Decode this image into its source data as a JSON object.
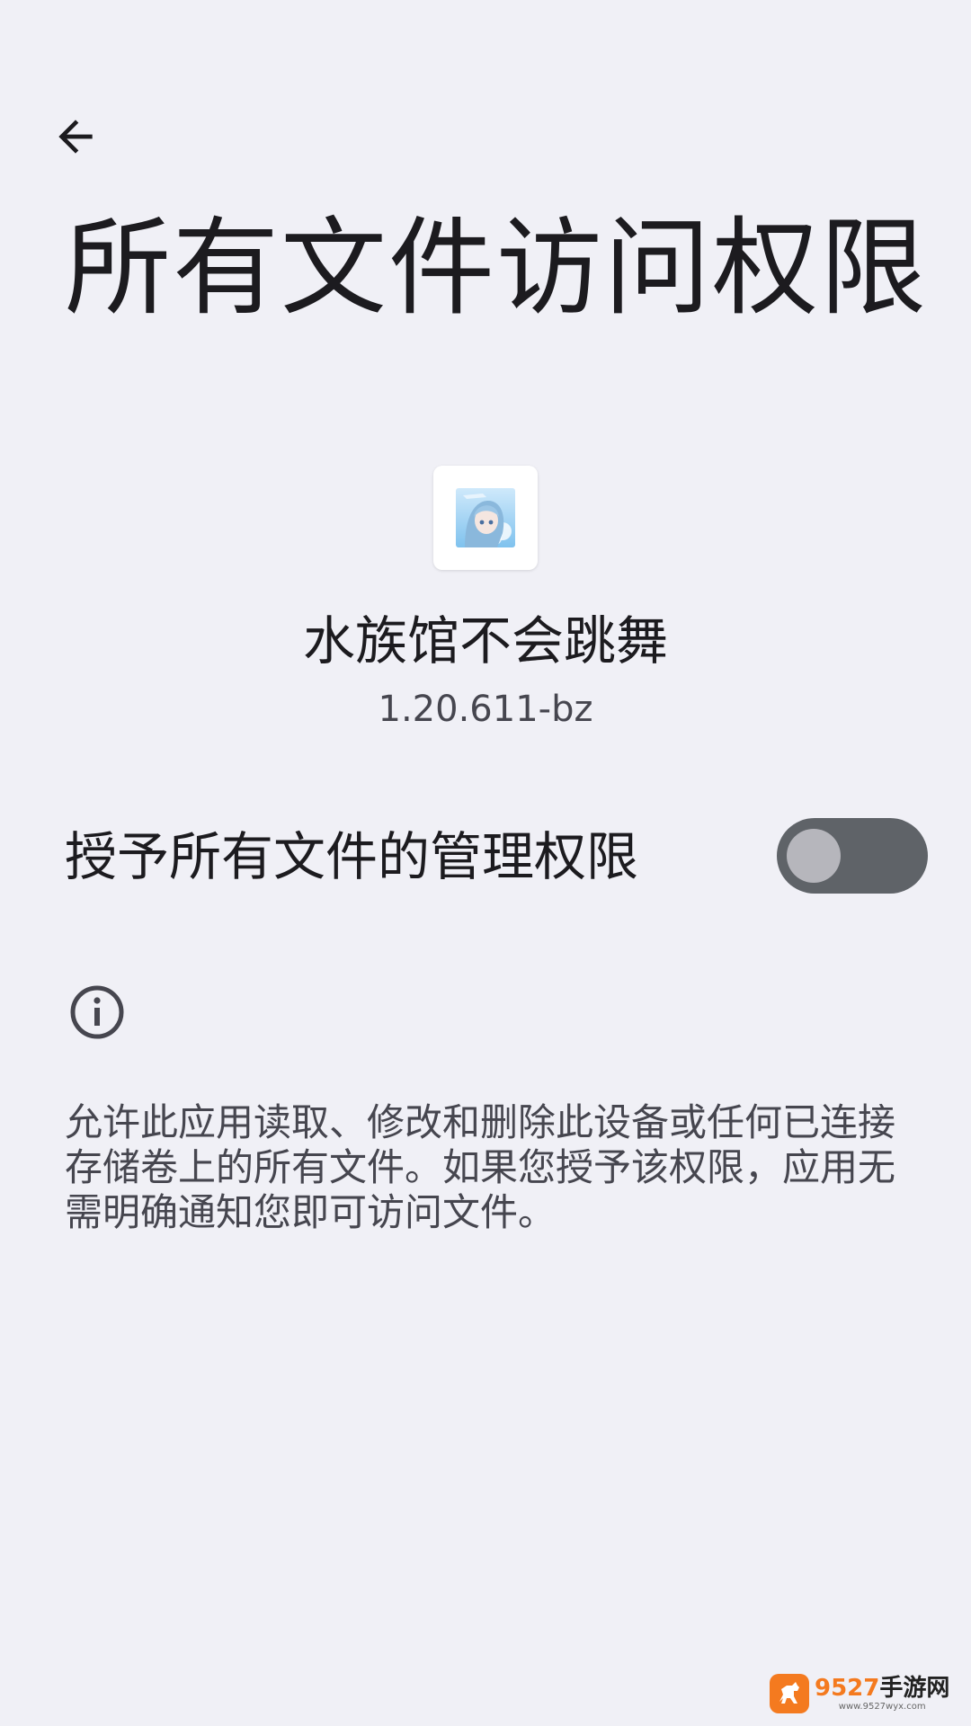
{
  "header": {
    "back_icon": "arrow-back-icon",
    "title": "所有文件访问权限"
  },
  "app": {
    "name": "水族馆不会跳舞",
    "version": "1.20.611-bz"
  },
  "permission": {
    "label": "授予所有文件的管理权限",
    "enabled": false
  },
  "info": {
    "icon": "info-icon",
    "description": "允许此应用读取、修改和删除此设备或任何已连接存储卷上的所有文件。如果您授予该权限，应用无需明确通知您即可访问文件。"
  },
  "watermark": {
    "name_number": "9527",
    "name_text": "手游网",
    "url": "www.9527wyx.com"
  },
  "colors": {
    "background": "#f0f0f6",
    "toggle_track": "#5f6368",
    "toggle_thumb": "#b6b6bc",
    "watermark_accent": "#f47a1f"
  }
}
